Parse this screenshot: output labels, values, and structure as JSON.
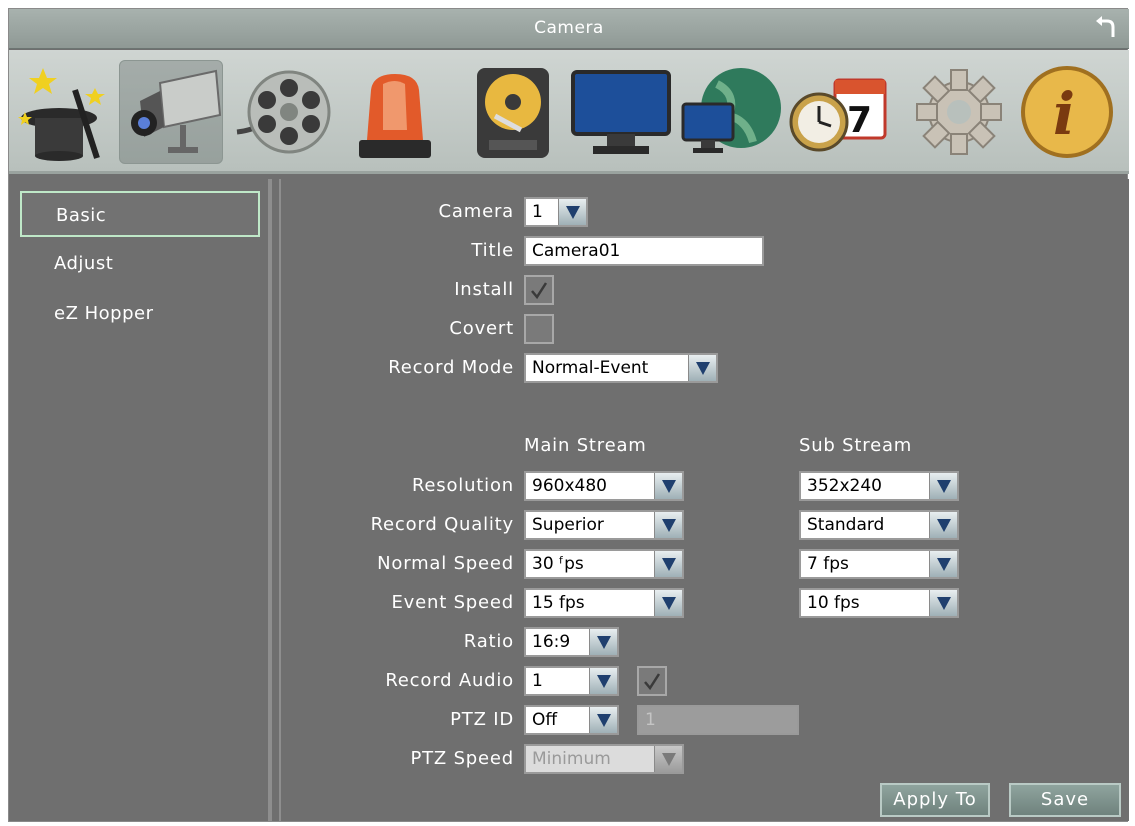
{
  "window": {
    "title": "Camera"
  },
  "toolbar": {
    "icons": [
      {
        "name": "wizard-icon"
      },
      {
        "name": "camera-icon"
      },
      {
        "name": "film-reel-icon"
      },
      {
        "name": "alarm-icon"
      },
      {
        "name": "hard-disk-icon"
      },
      {
        "name": "monitor-icon"
      },
      {
        "name": "network-icon"
      },
      {
        "name": "schedule-icon",
        "text": "7"
      },
      {
        "name": "settings-icon"
      },
      {
        "name": "info-icon",
        "text": "i"
      }
    ]
  },
  "sidebar": {
    "items": [
      {
        "label": "Basic"
      },
      {
        "label": "Adjust"
      },
      {
        "label": "eZ Hopper"
      }
    ]
  },
  "form": {
    "camera": {
      "label": "Camera",
      "value": "1"
    },
    "title": {
      "label": "Title",
      "value": "Camera01"
    },
    "install": {
      "label": "Install",
      "checked": true
    },
    "covert": {
      "label": "Covert",
      "checked": false
    },
    "record_mode": {
      "label": "Record Mode",
      "value": "Normal-Event"
    },
    "main_stream_header": "Main Stream",
    "sub_stream_header": "Sub Stream",
    "resolution": {
      "label": "Resolution",
      "main": "960x480",
      "sub": "352x240"
    },
    "record_quality": {
      "label": "Record Quality",
      "main": "Superior",
      "sub": "Standard"
    },
    "normal_speed": {
      "label": "Normal Speed",
      "main": "30 ᶠps",
      "sub": "7 fps"
    },
    "event_speed": {
      "label": "Event Speed",
      "main": "15 fps",
      "sub": "10 fps"
    },
    "ratio": {
      "label": "Ratio",
      "value": "16:9"
    },
    "record_audio": {
      "label": "Record Audio",
      "value": "1",
      "checked": true
    },
    "ptz_id": {
      "label": "PTZ ID",
      "value": "Off",
      "id_value": "1"
    },
    "ptz_speed": {
      "label": "PTZ Speed",
      "value": "Minimum"
    }
  },
  "buttons": {
    "apply_to": "Apply To",
    "save": "Save"
  },
  "colors": {
    "panel_bg": "#6f6f6f",
    "titlebar": "#9aa4a0",
    "active_outline": "#bfe8c8",
    "dropdown_arrow": "#1f3f6e"
  }
}
